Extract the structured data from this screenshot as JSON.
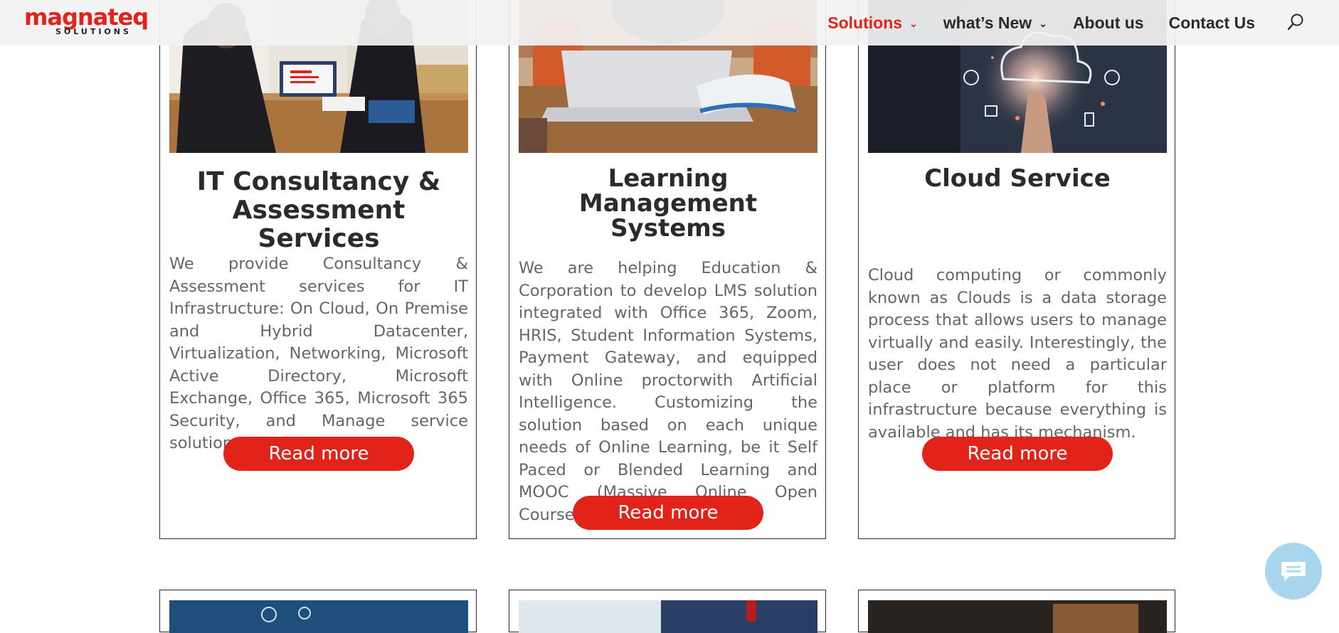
{
  "brand": {
    "name": "magnateq",
    "tagline": "SOLUTIONS",
    "accent": "#e2231a"
  },
  "nav": {
    "items": [
      {
        "label": "Solutions",
        "active": true,
        "has_dropdown": true
      },
      {
        "label": "what’s New",
        "active": false,
        "has_dropdown": true
      },
      {
        "label": "About us",
        "active": false,
        "has_dropdown": false
      },
      {
        "label": "Contact Us",
        "active": false,
        "has_dropdown": false
      }
    ],
    "search_icon": "search-icon"
  },
  "cards": [
    {
      "title": "IT Consultancy & Assessment Services",
      "description": "We provide Consultancy & Assessment services for IT Infrastructure: On Cloud, On Premise and Hybrid Datacenter, Virtualization, Networking, Microsoft Active Directory, Microsoft Exchange, Office 365, Microsoft 365 Security, and Manage service solution.",
      "button": "Read more"
    },
    {
      "title": "Learning Management Systems",
      "description": "We are helping Education & Corporation to develop LMS solution integrated with Office 365, Zoom, HRIS, Student Information Systems, Payment Gateway, and equipped with Online proctorwith Artificial Intelligence. Customizing the solution based on each unique needs of Online Learning, be it Self Paced or Blended Learning and MOOC (Massive Online Open Courses).",
      "button": "Read more"
    },
    {
      "title": "Cloud Service",
      "description": "Cloud computing or commonly known as Clouds is a data storage process that allows users to manage virtually and easily. Interestingly, the user does not need a particular place or platform for this infrastructure because everything is available and has its mechanism.",
      "button": "Read more"
    }
  ],
  "chat": {
    "icon": "chat-icon"
  }
}
